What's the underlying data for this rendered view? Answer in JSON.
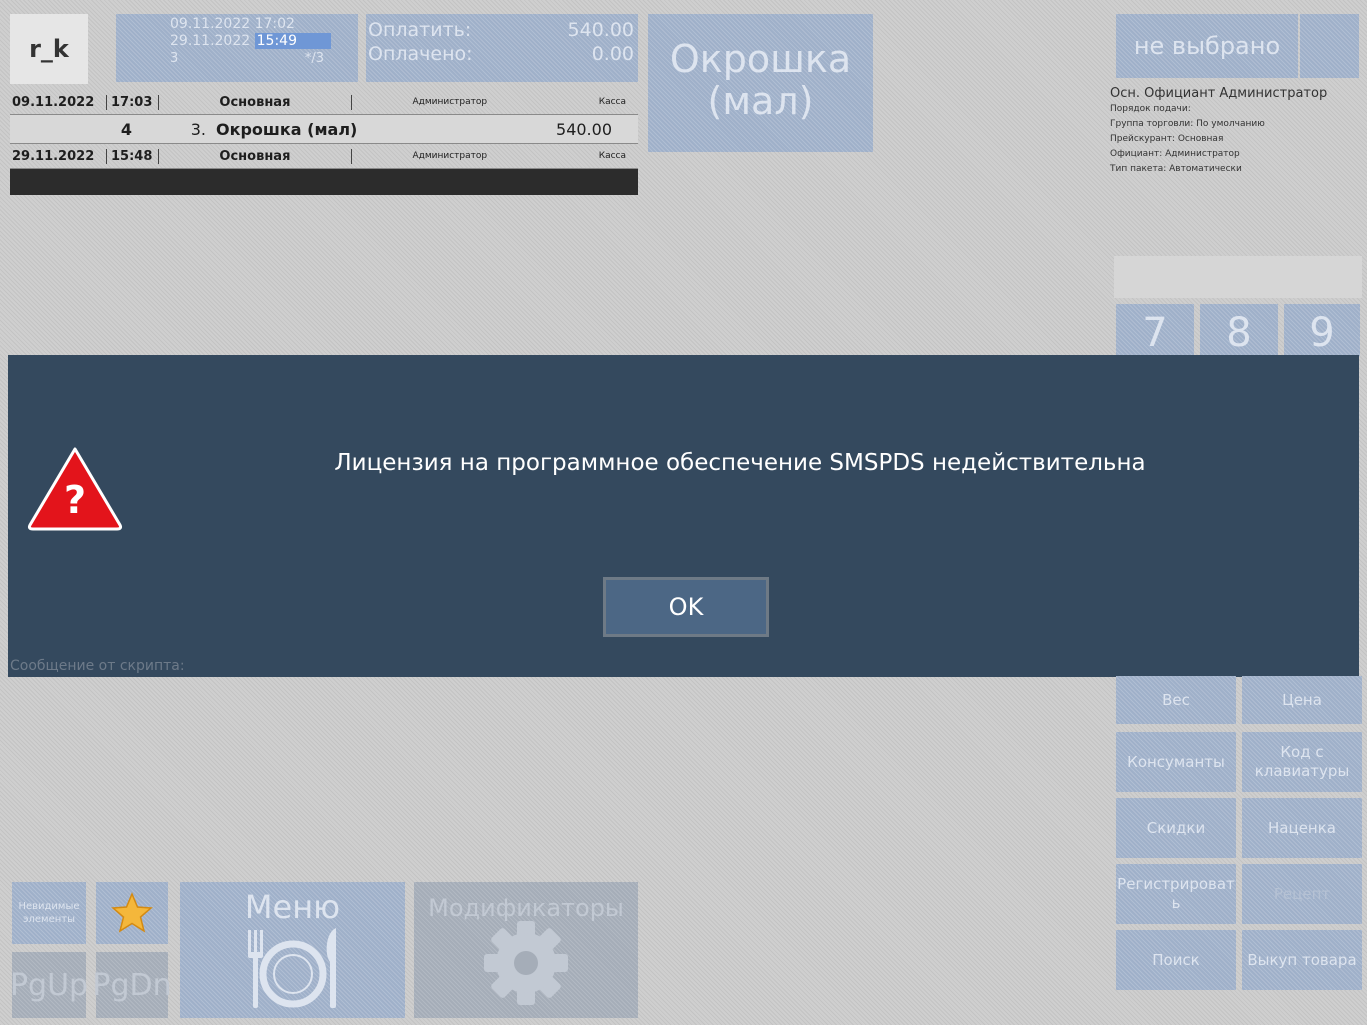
{
  "brand": {
    "label": "r_k"
  },
  "session": {
    "line1": "09.11.2022 17:02",
    "line2_date": "29.11.2022",
    "line2_time": "15:49",
    "guests": "3",
    "table_suffix": "*/3"
  },
  "payment": {
    "to_pay_label": "Оплатить:",
    "to_pay_value": "540.00",
    "paid_label": "Оплачено:",
    "paid_value": "0.00"
  },
  "selected_dish": {
    "line1": "Окрошка",
    "line2": "(мал)"
  },
  "waiter_select": {
    "label": "не выбрано"
  },
  "order_info": {
    "header": "Осн. Официант  Администратор",
    "lines": [
      "Порядок подачи:",
      "Группа торговли: По умолчанию",
      "Прейскурант: Основная",
      "Официант: Администратор",
      "Тип пакета: Автоматически"
    ]
  },
  "keypad": {
    "keys": [
      "7",
      "8",
      "9"
    ]
  },
  "order": {
    "row1": {
      "date": "09.11.2022",
      "time": "17:03",
      "type": "Основная",
      "user": "Администратор",
      "station": "Касса"
    },
    "item": {
      "qty": "4",
      "num": "3.",
      "name": "Окрошка (мал)",
      "price": "540.00"
    },
    "row2": {
      "date": "29.11.2022",
      "time": "15:48",
      "type": "Основная",
      "user": "Администратор",
      "station": "Касса"
    }
  },
  "dialog": {
    "message": "Лицензия на программное обеспечение SMSPDS недействительна",
    "ok_label": "OK"
  },
  "script_message_label": "Сообщение от скрипта:",
  "right_buttons": {
    "weight": "Вес",
    "price": "Цена",
    "consumables": "Консуманты",
    "keyboard_code": "Код с клавиатуры",
    "discounts": "Скидки",
    "markup": "Наценка",
    "register": "Регистрироват ь",
    "recipe": "Рецепт",
    "search": "Поиск",
    "buyback": "Выкуп товара"
  },
  "bottom": {
    "invisible": "Невидимые элементы",
    "pgup": "PgUp",
    "pgdn": "PgDn",
    "menu": "Меню",
    "modifiers": "Модификаторы"
  },
  "colors": {
    "dialog_bg": "#34495e",
    "ok_button": "#4c6785",
    "tile": "#9fb0c9",
    "warning": "#e3141b"
  }
}
